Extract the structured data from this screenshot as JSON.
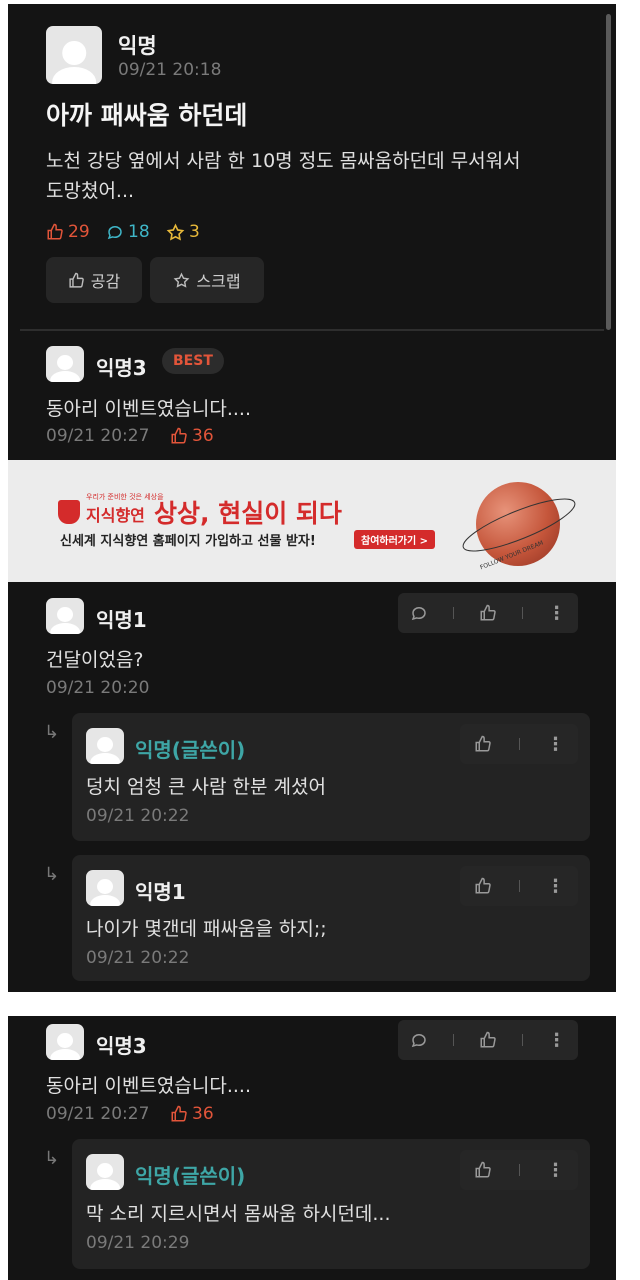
{
  "post": {
    "author": "익명",
    "time": "09/21 20:18",
    "title": "아까 패싸움 하던데",
    "body_line1": "노천 강당 옆에서 사람 한 10명 정도 몸싸움하던데 무서워서",
    "body_line2": "도망쳤어...",
    "likes": "29",
    "comments": "18",
    "scraps": "3",
    "like_button": "공감",
    "scrap_button": "스크랩"
  },
  "best_comment": {
    "author": "익명3",
    "badge": "BEST",
    "text": "동아리 이벤트였습니다....",
    "time": "09/21 20:27",
    "likes": "36"
  },
  "ad": {
    "brand_small": "우리가 준비한 것은 세상을",
    "brand": "지식향연",
    "headline": "상상, 현실이 되다",
    "subline": "신세계 지식향연 홈페이지 가입하고 선물 받자!",
    "cta": "참여하러가기 >",
    "planet_text": "FOLLOW YOUR DREAM"
  },
  "comments": [
    {
      "author": "익명1",
      "text": "건달이었음?",
      "time": "09/21 20:20",
      "replies": [
        {
          "author": "익명(글쓴이)",
          "text": "덩치 엄청 큰 사람 한분 계셨어",
          "time": "09/21 20:22"
        },
        {
          "author": "익명1",
          "text": "나이가 몇갠데 패싸움을 하지;;",
          "time": "09/21 20:22"
        }
      ]
    }
  ],
  "second_screen": {
    "author": "익명3",
    "text": "동아리 이벤트였습니다....",
    "time": "09/21 20:27",
    "likes": "36",
    "reply": {
      "author": "익명(글쓴이)",
      "text": "막 소리 지르시면서 몸싸움 하시던데...",
      "time": "09/21 20:29"
    }
  },
  "colors": {
    "background": "#141414",
    "like_red": "#e2553a",
    "comment_cyan": "#3fb6c8",
    "scrap_yellow": "#e8b93a",
    "op_teal": "#3ea6a6",
    "ad_red": "#d42b2b"
  },
  "icons": [
    "thumbs-up-icon",
    "speech-bubble-icon",
    "star-icon",
    "more-icon",
    "reply-arrow-icon"
  ]
}
